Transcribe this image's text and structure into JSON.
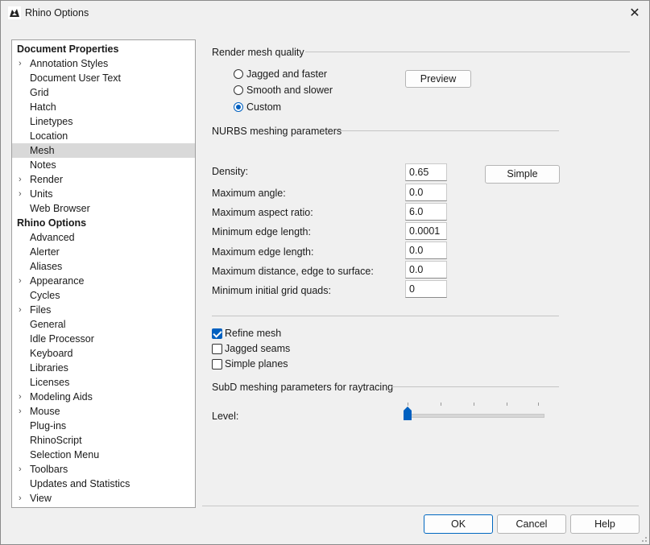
{
  "window": {
    "title": "Rhino Options",
    "close_symbol": "✕"
  },
  "tree": {
    "items": [
      {
        "label": "Document Properties",
        "header": true,
        "expandable": false,
        "selected": false
      },
      {
        "label": "Annotation Styles",
        "header": false,
        "expandable": true,
        "selected": false
      },
      {
        "label": "Document User Text",
        "header": false,
        "expandable": false,
        "selected": false
      },
      {
        "label": "Grid",
        "header": false,
        "expandable": false,
        "selected": false
      },
      {
        "label": "Hatch",
        "header": false,
        "expandable": false,
        "selected": false
      },
      {
        "label": "Linetypes",
        "header": false,
        "expandable": false,
        "selected": false
      },
      {
        "label": "Location",
        "header": false,
        "expandable": false,
        "selected": false
      },
      {
        "label": "Mesh",
        "header": false,
        "expandable": false,
        "selected": true
      },
      {
        "label": "Notes",
        "header": false,
        "expandable": false,
        "selected": false
      },
      {
        "label": "Render",
        "header": false,
        "expandable": true,
        "selected": false
      },
      {
        "label": "Units",
        "header": false,
        "expandable": true,
        "selected": false
      },
      {
        "label": "Web Browser",
        "header": false,
        "expandable": false,
        "selected": false
      },
      {
        "label": "Rhino Options",
        "header": true,
        "expandable": false,
        "selected": false
      },
      {
        "label": "Advanced",
        "header": false,
        "expandable": false,
        "selected": false
      },
      {
        "label": "Alerter",
        "header": false,
        "expandable": false,
        "selected": false
      },
      {
        "label": "Aliases",
        "header": false,
        "expandable": false,
        "selected": false
      },
      {
        "label": "Appearance",
        "header": false,
        "expandable": true,
        "selected": false
      },
      {
        "label": "Cycles",
        "header": false,
        "expandable": false,
        "selected": false
      },
      {
        "label": "Files",
        "header": false,
        "expandable": true,
        "selected": false
      },
      {
        "label": "General",
        "header": false,
        "expandable": false,
        "selected": false
      },
      {
        "label": "Idle Processor",
        "header": false,
        "expandable": false,
        "selected": false
      },
      {
        "label": "Keyboard",
        "header": false,
        "expandable": false,
        "selected": false
      },
      {
        "label": "Libraries",
        "header": false,
        "expandable": false,
        "selected": false
      },
      {
        "label": "Licenses",
        "header": false,
        "expandable": false,
        "selected": false
      },
      {
        "label": "Modeling Aids",
        "header": false,
        "expandable": true,
        "selected": false
      },
      {
        "label": "Mouse",
        "header": false,
        "expandable": true,
        "selected": false
      },
      {
        "label": "Plug-ins",
        "header": false,
        "expandable": false,
        "selected": false
      },
      {
        "label": "RhinoScript",
        "header": false,
        "expandable": false,
        "selected": false
      },
      {
        "label": "Selection Menu",
        "header": false,
        "expandable": false,
        "selected": false
      },
      {
        "label": "Toolbars",
        "header": false,
        "expandable": true,
        "selected": false
      },
      {
        "label": "Updates and Statistics",
        "header": false,
        "expandable": false,
        "selected": false
      },
      {
        "label": "View",
        "header": false,
        "expandable": true,
        "selected": false
      }
    ]
  },
  "render_mesh_quality": {
    "title": "Render mesh quality",
    "options": [
      {
        "label": "Jagged and faster",
        "checked": false
      },
      {
        "label": "Smooth and slower",
        "checked": false
      },
      {
        "label": "Custom",
        "checked": true
      }
    ],
    "preview_button": "Preview"
  },
  "nurbs": {
    "title": "NURBS meshing parameters",
    "simple_button": "Simple",
    "fields": [
      {
        "label": "Density:",
        "value": "0.65"
      },
      {
        "label": "Maximum angle:",
        "value": "0.0"
      },
      {
        "label": "Maximum aspect ratio:",
        "value": "6.0"
      },
      {
        "label": "Minimum edge length:",
        "value": "0.0001"
      },
      {
        "label": "Maximum edge length:",
        "value": "0.0"
      },
      {
        "label": "Maximum distance, edge to surface:",
        "value": "0.0"
      },
      {
        "label": "Minimum initial grid quads:",
        "value": "0"
      }
    ],
    "checkboxes": [
      {
        "label": "Refine mesh",
        "checked": true
      },
      {
        "label": "Jagged seams",
        "checked": false
      },
      {
        "label": "Simple planes",
        "checked": false
      }
    ]
  },
  "subd": {
    "title": "SubD meshing parameters for raytracing",
    "level_label": "Level:",
    "level_min": 1,
    "level_max": 5,
    "level_value": 1
  },
  "footer": {
    "ok": "OK",
    "cancel": "Cancel",
    "help": "Help"
  },
  "colors": {
    "accent": "#0060c0",
    "selected_row": "#d9d9d9"
  }
}
